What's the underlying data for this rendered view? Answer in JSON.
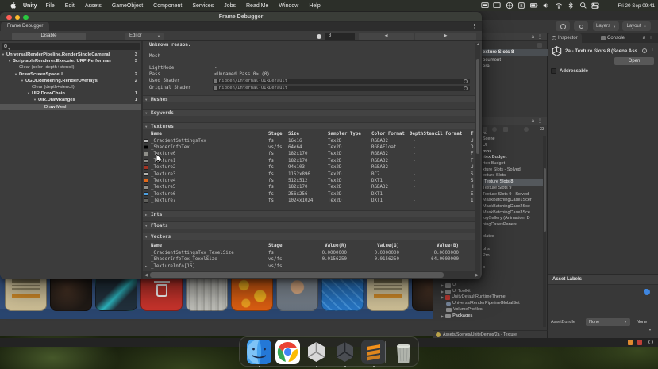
{
  "menu_bar": {
    "items": [
      "Unity",
      "File",
      "Edit",
      "Assets",
      "GameObject",
      "Component",
      "Services",
      "Jobs",
      "Read Me",
      "Window",
      "Help"
    ],
    "status_icon_names": [
      "display-mirror-icon",
      "display-icon",
      "globe-icon",
      "keyboard-icon",
      "battery-icon",
      "volume-icon",
      "wifi-icon",
      "bluetooth-icon",
      "search-icon",
      "control-center-icon"
    ],
    "clock": "Fri 20 Sep 09:41"
  },
  "frame_debugger": {
    "window_title": "Frame Debugger",
    "tab": "Frame Debugger",
    "toolbar": {
      "disable": "Disable",
      "target": "Editor",
      "event_value": "3",
      "prev": "◀",
      "next": "▶"
    },
    "tree": [
      {
        "t": "UniversalRenderPipeline.RenderSingleCameraI",
        "n": "3",
        "x": 8,
        "arrow": true,
        "bold": true
      },
      {
        "t": "ScriptableRenderer.Execute: URP-Performan",
        "n": "3",
        "x": 16,
        "arrow": true,
        "bold": true
      },
      {
        "t": "Clear (color+depth+stencil)",
        "n": "",
        "x": 24,
        "arrow": false,
        "bold": false
      },
      {
        "t": "DrawScreenSpaceUI",
        "n": "2",
        "x": 24,
        "arrow": true,
        "bold": true
      },
      {
        "t": "UGUI.Rendering.RenderOverlays",
        "n": "2",
        "x": 32,
        "arrow": true,
        "bold": true
      },
      {
        "t": "Clear (depth+stencil)",
        "n": "",
        "x": 40,
        "arrow": false,
        "bold": false
      },
      {
        "t": "UIR.DrawChain",
        "n": "1",
        "x": 40,
        "arrow": true,
        "bold": true
      },
      {
        "t": "UIR.DrawRanges",
        "n": "1",
        "x": 48,
        "arrow": true,
        "bold": true
      },
      {
        "t": "Draw Mesh",
        "n": "",
        "x": 56,
        "arrow": false,
        "bold": false,
        "selected": true
      }
    ],
    "details": {
      "reason": "Unknown reason.",
      "fields": [
        {
          "label": "Mesh",
          "value": "-"
        },
        {
          "label": "LightMode",
          "value": "-"
        },
        {
          "label": "Pass",
          "value": "<Unnamed Pass 0> (0)"
        }
      ],
      "shader_fields": [
        {
          "label": "Used Shader",
          "value": "Hidden/Internal-UIRDefault"
        },
        {
          "label": "Original Shader",
          "value": "Hidden/Internal-UIRDefault"
        }
      ],
      "meshes_title": "Meshes",
      "keywords_title": "Keywords",
      "textures": {
        "title": "Textures",
        "headers": [
          "Name",
          "Stage",
          "Size",
          "Sampler Type",
          "Color Format",
          "DepthStencil Format",
          "T"
        ],
        "rows": [
          {
            "name": "_GradientSettingsTex",
            "stage": "fs",
            "size": "16x16",
            "sampler": "Tex2D",
            "format": "RGBA32",
            "depth": "-",
            "t": "U",
            "sw": "#b8b8b8"
          },
          {
            "name": "_ShaderInfoTex",
            "stage": "vs/fs",
            "size": "64x64",
            "sampler": "Tex2D",
            "format": "RGBAFloat",
            "depth": "-",
            "t": "D",
            "sw": "#000000"
          },
          {
            "name": "_Texture0",
            "stage": "fs",
            "size": "182x170",
            "sampler": "Tex2D",
            "format": "RGBA32",
            "depth": "-",
            "t": "F",
            "sw": "#8f8f8a"
          },
          {
            "name": "_Texture1",
            "stage": "fs",
            "size": "182x170",
            "sampler": "Tex2D",
            "format": "RGBA32",
            "depth": "-",
            "t": "F",
            "sw": "#8f8f8a"
          },
          {
            "name": "_Texture2",
            "stage": "fs",
            "size": "94x103",
            "sampler": "Tex2D",
            "format": "RGBA32",
            "depth": "-",
            "t": "U",
            "sw": "#a23322"
          },
          {
            "name": "_Texture3",
            "stage": "fs",
            "size": "1152x896",
            "sampler": "Tex2D",
            "format": "BC7",
            "depth": "-",
            "t": "S",
            "sw": "#b4b4b0"
          },
          {
            "name": "_Texture4",
            "stage": "fs",
            "size": "512x512",
            "sampler": "Tex2D",
            "format": "DXT1",
            "depth": "-",
            "t": "S",
            "sw": "#e2691a"
          },
          {
            "name": "_Texture5",
            "stage": "fs",
            "size": "182x170",
            "sampler": "Tex2D",
            "format": "RGBA32",
            "depth": "-",
            "t": "H",
            "sw": "#8f8f8a"
          },
          {
            "name": "_Texture6",
            "stage": "fs",
            "size": "256x256",
            "sampler": "Tex2D",
            "format": "DXT1",
            "depth": "-",
            "t": "E",
            "sw": "#4da0e0"
          },
          {
            "name": "_Texture7",
            "stage": "fs",
            "size": "1024x1024",
            "sampler": "Tex2D",
            "format": "DXT1",
            "depth": "-",
            "t": "1",
            "sw": "#62625e"
          }
        ]
      },
      "ints_title": "Ints",
      "floats_title": "Floats",
      "vectors": {
        "title": "Vectors",
        "headers": [
          "Name",
          "Stage",
          "Value(R)",
          "Value(G)",
          "Value(B)"
        ],
        "rows": [
          {
            "name": "_GradientSettingsTex_TexelSize",
            "stage": "fs",
            "r": "0.0000000",
            "g": "0.0000000",
            "b": "0.0000000",
            "arrow": false
          },
          {
            "name": "_ShaderInfoTex_TexelSize",
            "stage": "vs/fs",
            "r": "0.0156250",
            "g": "0.0156250",
            "b": "64.0000000",
            "arrow": false
          },
          {
            "name": "_TextureInfo[16]",
            "stage": "vs/fs",
            "r": "",
            "g": "",
            "b": "",
            "arrow": true
          }
        ]
      }
    }
  },
  "editor": {
    "toolbar": {
      "layers": "Layers",
      "layout": "Layout"
    },
    "hierarchy": {
      "scene": "exture Slots 8",
      "items": [
        "ocument",
        "era"
      ]
    },
    "project": {
      "count": "33",
      "items": [
        {
          "y": 0,
          "t": "nu"
        },
        {
          "y": 1,
          "t": "Scene"
        },
        {
          "y": 2,
          "t": "UI"
        },
        {
          "y": 3,
          "t": "mos",
          "b": true
        },
        {
          "y": 4,
          "t": "rtex Budget",
          "b": true
        },
        {
          "y": 5,
          "t": "rtex Budget"
        },
        {
          "y": 6,
          "t": "xture Slots - Solved"
        },
        {
          "y": 7,
          "t": "exture Slots"
        },
        {
          "y": 8,
          "t": "Texture Slots 8",
          "sel": true
        },
        {
          "y": 9,
          "t": "Texture Slots 9"
        },
        {
          "y": 10,
          "t": "Texture Slots 9 - Solved"
        },
        {
          "y": 11,
          "t": "MaskBatchingCase1Scer"
        },
        {
          "y": 12,
          "t": "MaskBatchingCase2Sce"
        },
        {
          "y": 13,
          "t": "MaskBatchingCase3Sce"
        },
        {
          "y": 14,
          "t": "logGallery (Animation, D"
        },
        {
          "y": 15,
          "t": "hingCasesPanels"
        },
        {
          "y": 17,
          "t": "plates"
        },
        {
          "y": 19,
          "t": "phs"
        },
        {
          "y": 20,
          "t": "Pro"
        },
        {
          "y": 22,
          "t": "o"
        }
      ],
      "folders": [
        {
          "t": "UI",
          "icon": "folder",
          "arrow": true
        },
        {
          "t": "UI Toolkit",
          "icon": "folder",
          "arrow": true
        },
        {
          "t": "UnityDefaultRuntimeTheme",
          "icon": "theme",
          "arrow": true
        },
        {
          "t": "UniversalRenderPipelineGlobalSet",
          "icon": "gear",
          "arrow": false
        },
        {
          "t": "VolumeProfiles",
          "icon": "folder",
          "arrow": false
        },
        {
          "t": "Packages",
          "icon": "folder",
          "arrow": true,
          "b": true
        }
      ],
      "status": "Assets/Scenes/UniteDemos/2a - Texture"
    },
    "inspector": {
      "tabs": [
        "Inspector",
        "Console"
      ],
      "title": "2a - Texture Slots 8 (Scene Ass",
      "open": "Open",
      "addressable": "Addressable",
      "asset_labels": "Asset Labels",
      "asset_bundle": "AssetBundle",
      "bundle_value": "None",
      "variant_value": "None"
    },
    "game_cards": [
      "sample",
      "darkchar",
      "anime",
      "trash",
      "concrete",
      "lava",
      "boy",
      "diamond",
      "sample",
      "darkchar"
    ]
  },
  "dock": {
    "apps": [
      "finder",
      "chrome",
      "unity-hub",
      "unity",
      "sublime"
    ],
    "trash": "trash"
  }
}
